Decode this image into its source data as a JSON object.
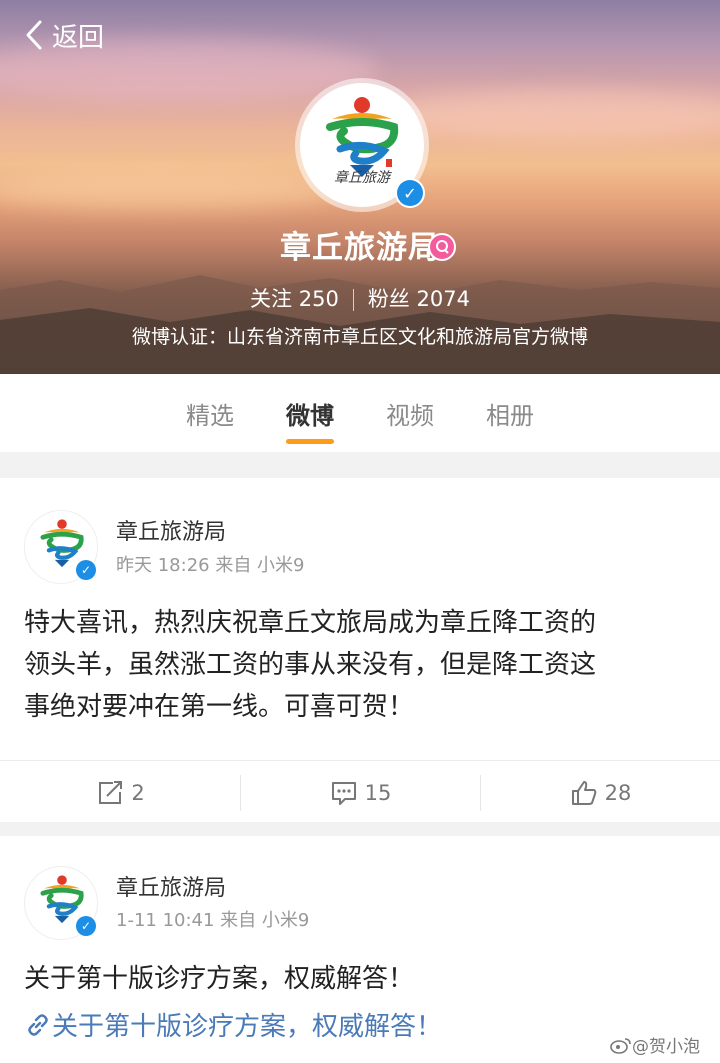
{
  "header": {
    "back_label": "返回",
    "avatar_caption": "章丘旅游",
    "name": "章丘旅游局",
    "following_label": "关注",
    "following_count": "250",
    "followers_label": "粉丝",
    "followers_count": "2074",
    "verification": "微博认证：山东省济南市章丘区文化和旅游局官方微博"
  },
  "tabs": [
    {
      "label": "精选"
    },
    {
      "label": "微博"
    },
    {
      "label": "视频"
    },
    {
      "label": "相册"
    }
  ],
  "active_tab": "微博",
  "posts": [
    {
      "author": "章丘旅游局",
      "meta": "昨天 18:26 来自 小米9",
      "text_lines": [
        "特大喜讯，热烈庆祝章丘文旅局成为章丘降工资的",
        "领头羊，虽然涨工资的事从来没有，但是降工资这",
        "事绝对要冲在第一线。可喜可贺！"
      ],
      "reposts": "2",
      "comments": "15",
      "likes": "28"
    },
    {
      "author": "章丘旅游局",
      "meta": "1-11 10:41 来自 小米9",
      "text": "关于第十版诊疗方案，权威解答！",
      "link_text": "关于第十版诊疗方案，权威解答！"
    }
  ],
  "watermark": "@贺小泡",
  "colors": {
    "accent_orange": "#ff9b1a",
    "verified_blue": "#1d8ee6",
    "link_blue": "#4a7ab8"
  }
}
